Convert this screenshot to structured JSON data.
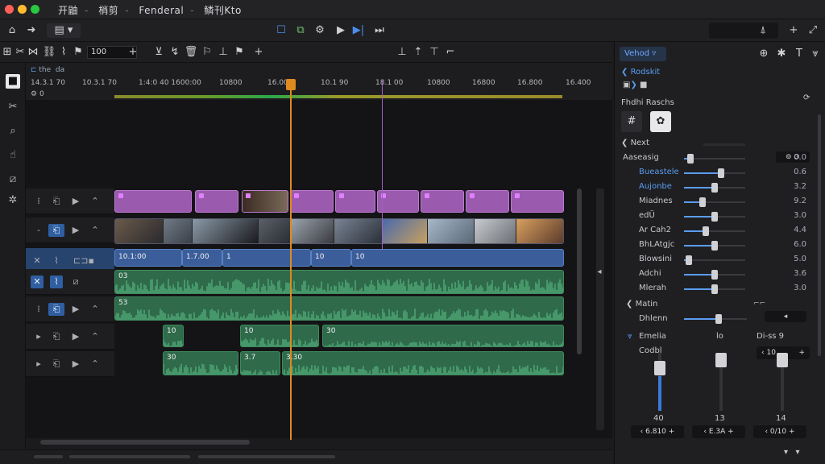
{
  "titlebar": {
    "menus": [
      "开鼬",
      "梢剪",
      "Fenderal",
      "鳞刊Kto"
    ],
    "traffic_colors": [
      "#ff5f57",
      "#febc2e",
      "#28c840"
    ]
  },
  "toolbar": {
    "icons": [
      "home-icon",
      "forward-icon",
      "layout-dropdown-icon",
      "square-icon",
      "transform-icon",
      "gear-icon",
      "play-icon",
      "play-step-icon",
      "skip-end-icon"
    ]
  },
  "timeline_tools": {
    "zoom_value": "100"
  },
  "ruler": {
    "sub_label": "the",
    "sub_label2": "da",
    "zero_label": "0",
    "ticks": [
      "14.3.1 70",
      "10.3.1 70",
      "1:4:0 40 1600:00",
      "10800",
      "16.00",
      "10.1 90",
      "18.1 00",
      "10800",
      "16800",
      "16.800",
      "16.400"
    ]
  },
  "tracks": {
    "purple_clip_labels": [
      "",
      "",
      "",
      "",
      "",
      "",
      "",
      "",
      ""
    ],
    "blue_clip_labels": [
      "10.1:00",
      "1.7.00",
      "1",
      "10",
      "10"
    ],
    "audio_labels": [
      "03",
      "53",
      "10",
      "10",
      "30",
      "30",
      "3.7",
      "3.30"
    ]
  },
  "inspector": {
    "tab_label": "Vehod",
    "section_header": "Rodskit",
    "panel_title": "Fhdhi Raschs",
    "group_next": "Next",
    "rows": [
      {
        "label": "Aaseasig",
        "value": "0.0",
        "level": 0.1,
        "blue": false
      },
      {
        "label": "Bueastele",
        "value": "0.6",
        "level": 0.6,
        "blue": true
      },
      {
        "label": "Aujonbe",
        "value": "3.2",
        "level": 0.5,
        "blue": true
      },
      {
        "label": "Miadnes",
        "value": "9.2",
        "level": 0.3,
        "blue": false
      },
      {
        "label": "edÜ",
        "value": "3.0",
        "level": 0.5,
        "blue": false
      },
      {
        "label": "Ar Cah2",
        "value": "4.4",
        "level": 0.35,
        "blue": false
      },
      {
        "label": "BhLAtgjc",
        "value": "6.0",
        "level": 0.5,
        "blue": false
      },
      {
        "label": "Blowsini",
        "value": "5.0",
        "level": 0.08,
        "blue": false
      },
      {
        "label": "Adchi",
        "value": "3.6",
        "level": 0.5,
        "blue": false
      },
      {
        "label": "Mlerah",
        "value": "3.0",
        "level": 0.5,
        "blue": false
      }
    ],
    "group_matin": "Matin",
    "dhlenn_label": "Dhlenn",
    "dhlenn_level": 0.55,
    "mixer_header": [
      "Emelia",
      "lo",
      "Di-ss 9"
    ],
    "mixer_sub": "Codbl",
    "mixer_box_value": "10",
    "mixer_values": [
      "40",
      "13",
      "14"
    ],
    "mixer_levels": [
      0.85,
      0.1,
      0.1
    ],
    "bottom_boxes": [
      "6.810",
      "E.3A",
      "0/10"
    ]
  }
}
